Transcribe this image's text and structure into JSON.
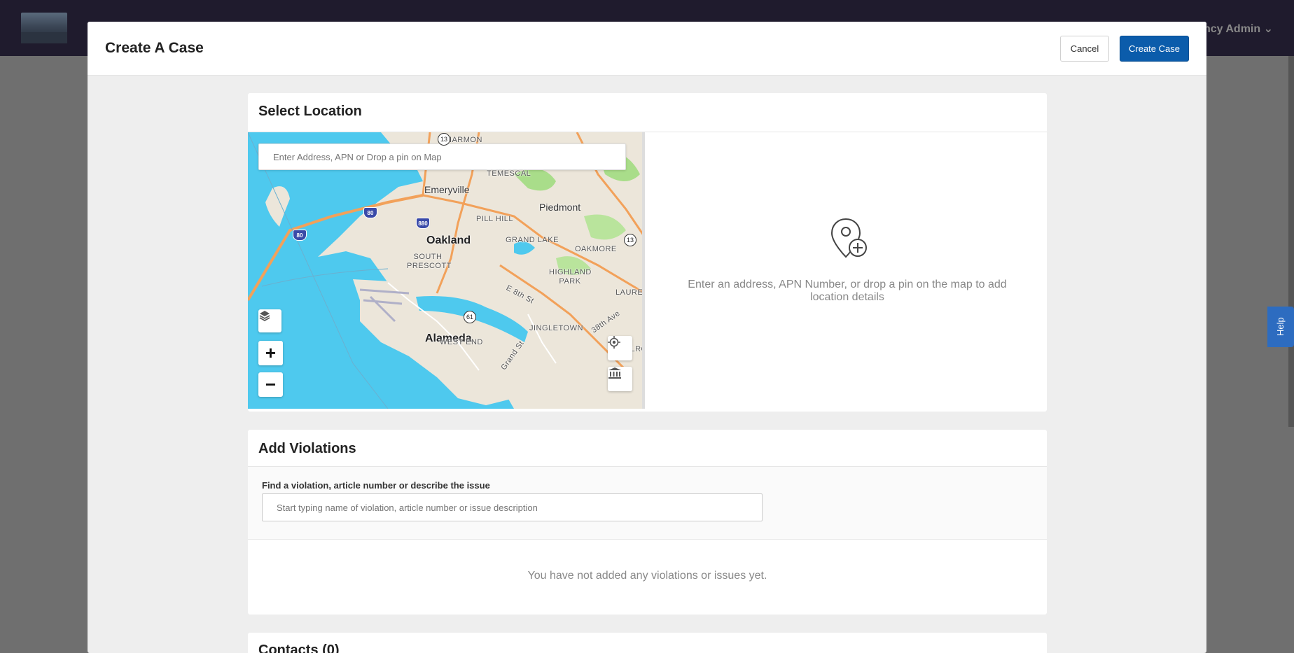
{
  "app": {
    "user_menu_label": "ency Admin",
    "help_label": "Help"
  },
  "modal": {
    "title": "Create A Case",
    "cancel_label": "Cancel",
    "create_label": "Create Case"
  },
  "location": {
    "title": "Select Location",
    "search_placeholder": "Enter Address, APN or Drop a pin on Map",
    "empty_text": "Enter an address, APN Number, or drop a pin on the map to add location details",
    "map": {
      "places": [
        "Emeryville",
        "Piedmont",
        "Oakland",
        "Alameda"
      ],
      "neighborhoods": [
        "HARMON",
        "TEMESCAL",
        "PILL HILL",
        "GRAND LAKE",
        "OAKMORE",
        "SOUTH PRESCOTT",
        "HIGHLAND PARK",
        "LAUREL",
        "JINGLETOWN",
        "WEST END",
        "MELROSE"
      ],
      "streets": [
        "E 8th St",
        "38th Ave",
        "Grand St"
      ],
      "highways": [
        "80",
        "80",
        "880",
        "13",
        "13",
        "61"
      ],
      "zoom_in": "+",
      "zoom_out": "−"
    }
  },
  "violations": {
    "title": "Add Violations",
    "search_label": "Find a violation, article number or describe the issue",
    "search_placeholder": "Start typing name of violation, article number or issue description",
    "empty_text": "You have not added any violations or issues yet."
  },
  "contacts": {
    "title": "Contacts (0)"
  }
}
